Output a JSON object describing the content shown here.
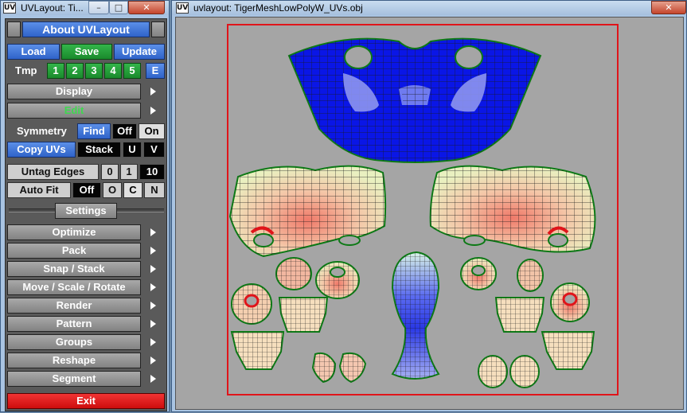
{
  "left_window": {
    "title": "UVLayout: Ti...",
    "about_label": "About UVLayout",
    "load_label": "Load",
    "save_label": "Save",
    "update_label": "Update",
    "tmp_label": "Tmp",
    "tmp_slots": [
      "1",
      "2",
      "3",
      "4",
      "5"
    ],
    "tmp_edit_label": "E",
    "menu_display": "Display",
    "menu_edit": "Edit",
    "symmetry_label": "Symmetry",
    "find_label": "Find",
    "off_label": "Off",
    "on_label": "On",
    "copy_uvs_label": "Copy UVs",
    "stack_label": "Stack",
    "u_label": "U",
    "v_label": "V",
    "untag_edges_label": "Untag Edges",
    "untag_values": [
      "0",
      "1",
      "10"
    ],
    "auto_fit_label": "Auto Fit",
    "auto_fit_off": "Off",
    "auto_fit_o": "O",
    "auto_fit_c": "C",
    "auto_fit_n": "N",
    "settings_label": "Settings",
    "menu_items": [
      "Optimize",
      "Pack",
      "Snap / Stack",
      "Move / Scale / Rotate",
      "Render",
      "Pattern",
      "Groups",
      "Reshape",
      "Segment"
    ],
    "exit_label": "Exit"
  },
  "right_window": {
    "title": "uvlayout: TigerMeshLowPolyW_UVs.obj"
  },
  "colors": {
    "viewport_bg": "#a5a5a5",
    "uv_border": "#e0141a",
    "shell_outline": "#0d7a16",
    "blue_shell": "#0a16e6",
    "accent_blue": "#2f63c9",
    "accent_green": "#1a8a2c",
    "exit_red": "#cc0d0d"
  }
}
